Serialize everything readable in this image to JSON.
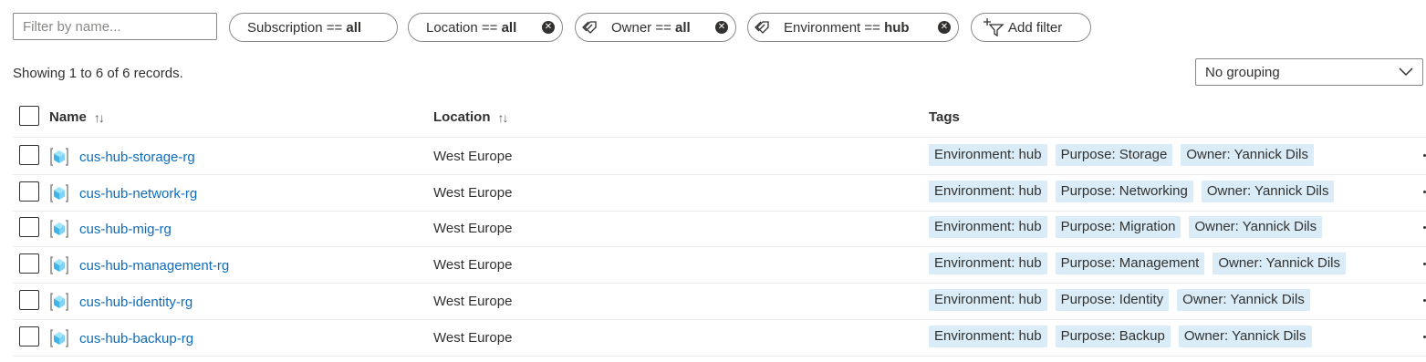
{
  "filter": {
    "placeholder": "Filter by name..."
  },
  "pills": [
    {
      "key": "Subscription",
      "op": " == ",
      "value": "all"
    },
    {
      "key": "Location",
      "op": " == ",
      "value": "all"
    },
    {
      "key": "Owner",
      "op": " == ",
      "value": "all"
    },
    {
      "key": "Environment",
      "op": " == ",
      "value": "hub"
    }
  ],
  "add_filter_label": "Add filter",
  "showing": "Showing 1 to 6 of 6 records.",
  "grouping": "No grouping",
  "columns": {
    "name": "Name",
    "location": "Location",
    "tags": "Tags"
  },
  "rows": [
    {
      "name": "cus-hub-storage-rg",
      "location": "West Europe",
      "tags": [
        "Environment: hub",
        "Purpose: Storage",
        "Owner: Yannick Dils"
      ]
    },
    {
      "name": "cus-hub-network-rg",
      "location": "West Europe",
      "tags": [
        "Environment: hub",
        "Purpose: Networking",
        "Owner: Yannick Dils"
      ]
    },
    {
      "name": "cus-hub-mig-rg",
      "location": "West Europe",
      "tags": [
        "Environment: hub",
        "Purpose: Migration",
        "Owner: Yannick Dils"
      ]
    },
    {
      "name": "cus-hub-management-rg",
      "location": "West Europe",
      "tags": [
        "Environment: hub",
        "Purpose: Management",
        "Owner: Yannick Dils"
      ]
    },
    {
      "name": "cus-hub-identity-rg",
      "location": "West Europe",
      "tags": [
        "Environment: hub",
        "Purpose: Identity",
        "Owner: Yannick Dils"
      ]
    },
    {
      "name": "cus-hub-backup-rg",
      "location": "West Europe",
      "tags": [
        "Environment: hub",
        "Purpose: Backup",
        "Owner: Yannick Dils"
      ]
    }
  ],
  "colors": {
    "link": "#0f6cbd",
    "tag_bg": "#d9ecf7",
    "border": "#8a8886"
  },
  "icons": {
    "pill_remove": "close-circle-icon",
    "pill_tag": "tag-icon",
    "add_filter": "add-filter-icon",
    "dropdown": "chevron-down-icon",
    "row": "resource-group-icon",
    "sort": "sort-arrows-icon"
  }
}
